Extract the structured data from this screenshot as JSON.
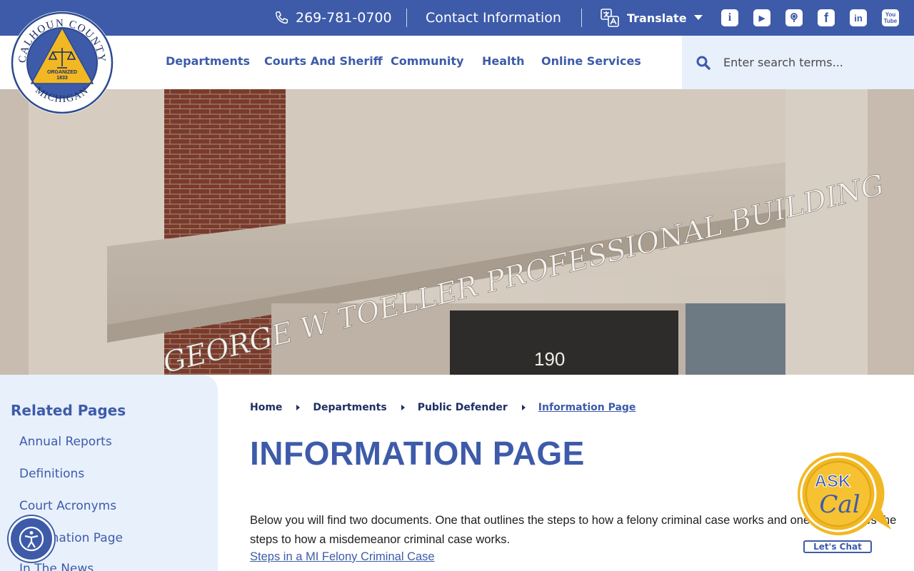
{
  "topbar": {
    "phone": "269-781-0700",
    "contact_label": "Contact Information",
    "translate_label": "Translate",
    "social": [
      {
        "name": "info-icon",
        "glyph": "i"
      },
      {
        "name": "youtube-icon",
        "glyph": "▶"
      },
      {
        "name": "podcast-icon",
        "glyph": ""
      },
      {
        "name": "facebook-icon",
        "glyph": "f"
      },
      {
        "name": "linkedin-icon",
        "glyph": "in"
      },
      {
        "name": "youtube-text-icon",
        "glyph": "You Tube"
      }
    ]
  },
  "logo": {
    "top_text": "CALHOUN COUNTY",
    "bottom_text": "MICHIGAN",
    "organized": "ORGANIZED",
    "year": "1833"
  },
  "nav": {
    "items": [
      "Departments",
      "Courts And Sheriff",
      "Community",
      "Health",
      "Online Services"
    ]
  },
  "search": {
    "placeholder": "Enter search terms..."
  },
  "hero": {
    "sign_text": "GEORGE W TOELLER PROFESSIONAL BUILDING",
    "address_number": "190"
  },
  "sidebar": {
    "title": "Related Pages",
    "links": [
      "Annual Reports",
      "Definitions",
      "Court Acronyms",
      "Information Page",
      "In The News"
    ]
  },
  "breadcrumb": {
    "items": [
      "Home",
      "Departments",
      "Public Defender"
    ],
    "current": "Information Page"
  },
  "main": {
    "title": "INFORMATION PAGE",
    "intro": "Below you will find two documents. One that outlines the steps to how a felony criminal case works and one that outlines the steps to how a misdemeanor criminal case works.",
    "link": "Steps in a MI Felony Criminal Case"
  },
  "askcal": {
    "ask": "ASK",
    "cal": "Cal",
    "chat_label": "Let's Chat"
  },
  "colors": {
    "brand_blue": "#3d5ba9",
    "light_blue": "#e8f0fc",
    "gold": "#f2b824"
  }
}
